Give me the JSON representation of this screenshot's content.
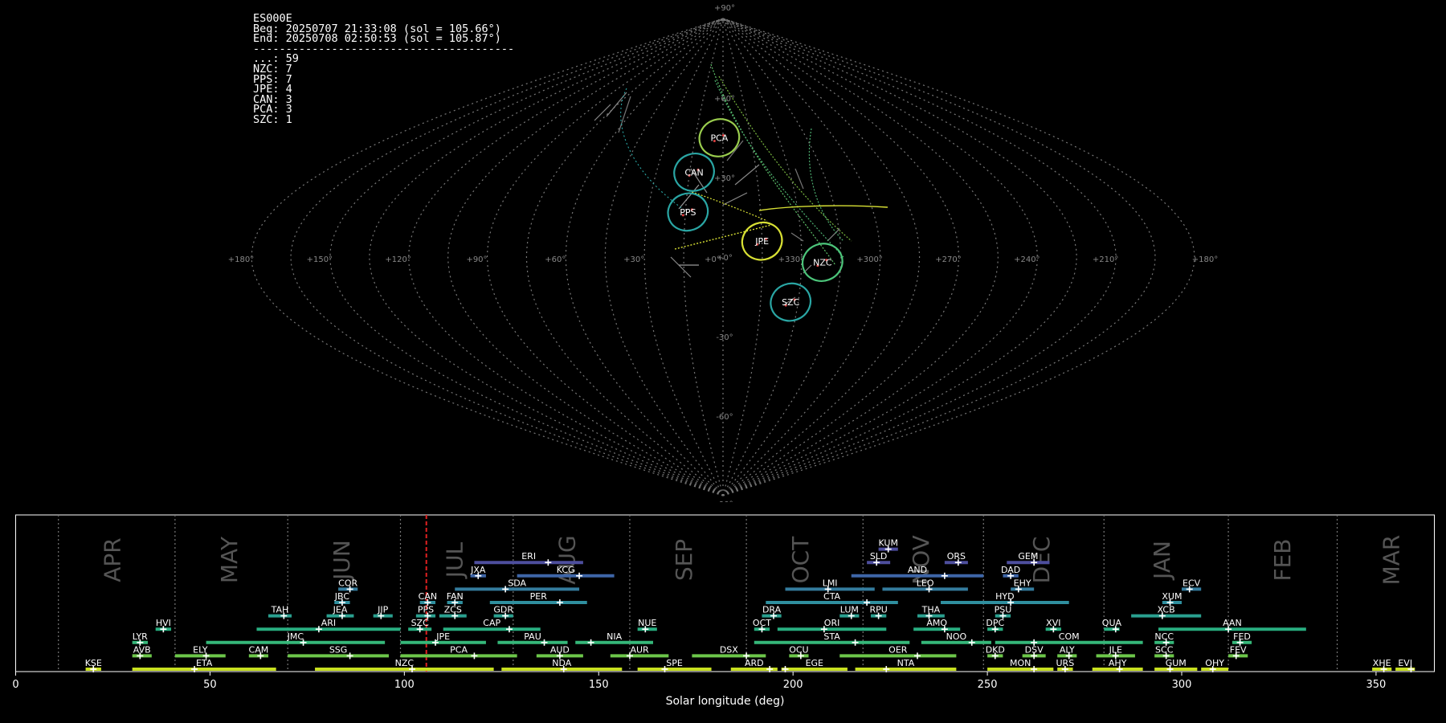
{
  "info": {
    "station": "ES000E",
    "beg": "Beg: 20250707 21:33:08 (sol = 105.66°)",
    "end": "End: 20250708 02:50:53 (sol = 105.87°)",
    "separator": "----------------------------------------",
    "counts": [
      {
        "label": "...",
        "count": 59
      },
      {
        "label": "NZC",
        "count": 7
      },
      {
        "label": "PPS",
        "count": 7
      },
      {
        "label": "JPE",
        "count": 4
      },
      {
        "label": "CAN",
        "count": 3
      },
      {
        "label": "PCA",
        "count": 3
      },
      {
        "label": "SZC",
        "count": 1
      }
    ]
  },
  "chart_data": [
    {
      "type": "scatter",
      "projection": "sinusoidal",
      "grid": true,
      "ra_ticks": [
        "+180°",
        "+150°",
        "+120°",
        "+90°",
        "+60°",
        "+30°",
        "+0°",
        "+330°",
        "+300°",
        "+270°",
        "+240°",
        "+210°",
        "+180°"
      ],
      "ra_tick_values": [
        180,
        150,
        120,
        90,
        60,
        30,
        0,
        330,
        300,
        270,
        240,
        210,
        180
      ],
      "dec_ticks": [
        "+90°",
        "+60°",
        "+30°",
        "+0°",
        "-30°",
        "-60°",
        "-90°"
      ],
      "dec_tick_values": [
        90,
        60,
        30,
        0,
        -30,
        -60,
        -90
      ],
      "radiants": [
        {
          "name": "PCA",
          "ra": 2,
          "dec": 45,
          "color": "#9acd4e"
        },
        {
          "name": "CAN",
          "ra": 13,
          "dec": 32,
          "color": "#2aa6a4"
        },
        {
          "name": "PPS",
          "ra": 14,
          "dec": 17,
          "color": "#2aa6a4"
        },
        {
          "name": "JPE",
          "ra": 345,
          "dec": 6,
          "color": "#d8e034"
        },
        {
          "name": "NZC",
          "ra": 322,
          "dec": -2,
          "color": "#4cc57a"
        },
        {
          "name": "SZC",
          "ra": 333,
          "dec": -17,
          "color": "#2aa6a4"
        }
      ]
    },
    {
      "type": "timeline",
      "xlabel": "Solar longitude (deg)",
      "xlim": [
        0,
        365
      ],
      "xticks": [
        0,
        50,
        100,
        150,
        200,
        250,
        300,
        350
      ],
      "current_sol": 105.66,
      "months": [
        {
          "name": "APR",
          "sol": 24
        },
        {
          "name": "MAY",
          "sol": 54
        },
        {
          "name": "JUN",
          "sol": 83
        },
        {
          "name": "JUL",
          "sol": 112
        },
        {
          "name": "AUG",
          "sol": 141
        },
        {
          "name": "SEP",
          "sol": 171
        },
        {
          "name": "OCT",
          "sol": 201
        },
        {
          "name": "NOV",
          "sol": 232
        },
        {
          "name": "DEC",
          "sol": 263
        },
        {
          "name": "JAN",
          "sol": 294
        },
        {
          "name": "FEB",
          "sol": 325
        },
        {
          "name": "MAR",
          "sol": 353
        }
      ],
      "month_bounds": [
        11,
        41,
        70,
        99,
        128,
        158,
        188,
        218,
        249,
        280,
        312,
        340
      ],
      "showers": [
        {
          "name": "KUM",
          "row": 10,
          "start": 222,
          "end": 227,
          "peak": 224.5,
          "color": "#4d4e9e"
        },
        {
          "name": "ERI",
          "row": 9,
          "start": 118,
          "end": 146,
          "peak": 137,
          "color": "#4d4e9e"
        },
        {
          "name": "SLD",
          "row": 9,
          "start": 219,
          "end": 225,
          "peak": 221.5,
          "color": "#4d4e9e"
        },
        {
          "name": "ORS",
          "row": 9,
          "start": 239,
          "end": 245,
          "peak": 242.5,
          "color": "#4d4e9e"
        },
        {
          "name": "GEM",
          "row": 9,
          "start": 255,
          "end": 266,
          "peak": 262,
          "color": "#4d4e9e"
        },
        {
          "name": "JXA",
          "row": 8,
          "start": 117,
          "end": 121,
          "peak": 119,
          "color": "#3e66a8"
        },
        {
          "name": "KCG",
          "row": 8,
          "start": 129,
          "end": 154,
          "peak": 145,
          "color": "#3e66a8"
        },
        {
          "name": "AND",
          "row": 8,
          "start": 215,
          "end": 249,
          "peak": 239,
          "color": "#3e66a8"
        },
        {
          "name": "DAD",
          "row": 8,
          "start": 254,
          "end": 258,
          "peak": 256,
          "color": "#3e66a8"
        },
        {
          "name": "COR",
          "row": 7,
          "start": 83,
          "end": 88,
          "peak": 86,
          "color": "#347c9e"
        },
        {
          "name": "SDA",
          "row": 7,
          "start": 113,
          "end": 145,
          "peak": 126,
          "color": "#347c9e"
        },
        {
          "name": "LMI",
          "row": 7,
          "start": 198,
          "end": 221,
          "peak": 209,
          "color": "#347c9e"
        },
        {
          "name": "LEO",
          "row": 7,
          "start": 223,
          "end": 245,
          "peak": 235,
          "color": "#347c9e"
        },
        {
          "name": "EHY",
          "row": 7,
          "start": 256,
          "end": 262,
          "peak": 258,
          "color": "#347c9e"
        },
        {
          "name": "ECV",
          "row": 7,
          "start": 300,
          "end": 305,
          "peak": 302,
          "color": "#347c9e"
        },
        {
          "name": "JBC",
          "row": 6,
          "start": 82,
          "end": 86,
          "peak": 84,
          "color": "#2f8f9f"
        },
        {
          "name": "CAN",
          "row": 6,
          "start": 104,
          "end": 108,
          "peak": 106,
          "color": "#2f8f9f"
        },
        {
          "name": "FAN",
          "row": 6,
          "start": 111,
          "end": 115,
          "peak": 113,
          "color": "#2f8f9f"
        },
        {
          "name": "PER",
          "row": 6,
          "start": 122,
          "end": 147,
          "peak": 140,
          "color": "#2f8f9f"
        },
        {
          "name": "CTA",
          "row": 6,
          "start": 193,
          "end": 227,
          "peak": 219,
          "color": "#2f8f9f"
        },
        {
          "name": "HYD",
          "row": 6,
          "start": 238,
          "end": 271,
          "peak": 256,
          "color": "#2f8f9f"
        },
        {
          "name": "XUM",
          "row": 6,
          "start": 295,
          "end": 300,
          "peak": 297,
          "color": "#2f8f9f"
        },
        {
          "name": "TAH",
          "row": 5,
          "start": 65,
          "end": 71,
          "peak": 69,
          "color": "#2aa08f"
        },
        {
          "name": "JEA",
          "row": 5,
          "start": 80,
          "end": 87,
          "peak": 84,
          "color": "#2aa08f"
        },
        {
          "name": "JIP",
          "row": 5,
          "start": 92,
          "end": 97,
          "peak": 94,
          "color": "#2aa08f"
        },
        {
          "name": "PPS",
          "row": 5,
          "start": 103,
          "end": 108,
          "peak": 106,
          "color": "#2aa08f"
        },
        {
          "name": "ZCS",
          "row": 5,
          "start": 109,
          "end": 116,
          "peak": 113,
          "color": "#2aa08f"
        },
        {
          "name": "GDR",
          "row": 5,
          "start": 123,
          "end": 128,
          "peak": 126,
          "color": "#2aa08f"
        },
        {
          "name": "DRA",
          "row": 5,
          "start": 192,
          "end": 197,
          "peak": 195,
          "color": "#2aa08f"
        },
        {
          "name": "LUM",
          "row": 5,
          "start": 212,
          "end": 217,
          "peak": 215,
          "color": "#2aa08f"
        },
        {
          "name": "RPU",
          "row": 5,
          "start": 220,
          "end": 224,
          "peak": 222,
          "color": "#2aa08f"
        },
        {
          "name": "THA",
          "row": 5,
          "start": 232,
          "end": 239,
          "peak": 235,
          "color": "#2aa08f"
        },
        {
          "name": "PSU",
          "row": 5,
          "start": 252,
          "end": 256,
          "peak": 254,
          "color": "#2aa08f"
        },
        {
          "name": "XCB",
          "row": 5,
          "start": 287,
          "end": 305,
          "peak": 295,
          "color": "#2aa08f"
        },
        {
          "name": "HVI",
          "row": 4,
          "start": 36,
          "end": 40,
          "peak": 38,
          "color": "#28ae80"
        },
        {
          "name": "ARI",
          "row": 4,
          "start": 62,
          "end": 99,
          "peak": 78,
          "color": "#28ae80"
        },
        {
          "name": "SZC",
          "row": 4,
          "start": 101,
          "end": 107,
          "peak": 104,
          "color": "#28ae80"
        },
        {
          "name": "CAP",
          "row": 4,
          "start": 110,
          "end": 135,
          "peak": 127,
          "color": "#28ae80"
        },
        {
          "name": "NUE",
          "row": 4,
          "start": 160,
          "end": 165,
          "peak": 162,
          "color": "#28ae80"
        },
        {
          "name": "OCT",
          "row": 4,
          "start": 190,
          "end": 194,
          "peak": 192,
          "color": "#28ae80"
        },
        {
          "name": "ORI",
          "row": 4,
          "start": 196,
          "end": 224,
          "peak": 208,
          "color": "#28ae80"
        },
        {
          "name": "AMO",
          "row": 4,
          "start": 231,
          "end": 243,
          "peak": 239,
          "color": "#28ae80"
        },
        {
          "name": "DPC",
          "row": 4,
          "start": 250,
          "end": 254,
          "peak": 252,
          "color": "#28ae80"
        },
        {
          "name": "XVI",
          "row": 4,
          "start": 265,
          "end": 269,
          "peak": 267,
          "color": "#28ae80"
        },
        {
          "name": "QUA",
          "row": 4,
          "start": 280,
          "end": 284,
          "peak": 283,
          "color": "#28ae80"
        },
        {
          "name": "AAN",
          "row": 4,
          "start": 294,
          "end": 332,
          "peak": 312,
          "color": "#28ae80"
        },
        {
          "name": "LYR",
          "row": 3,
          "start": 30,
          "end": 34,
          "peak": 32,
          "color": "#35b779"
        },
        {
          "name": "JMC",
          "row": 3,
          "start": 49,
          "end": 95,
          "peak": 74,
          "color": "#35b779"
        },
        {
          "name": "JPE",
          "row": 3,
          "start": 99,
          "end": 121,
          "peak": 108,
          "color": "#35b779"
        },
        {
          "name": "PAU",
          "row": 3,
          "start": 124,
          "end": 142,
          "peak": 136,
          "color": "#35b779"
        },
        {
          "name": "NIA",
          "row": 3,
          "start": 144,
          "end": 164,
          "peak": 148,
          "color": "#35b779"
        },
        {
          "name": "STA",
          "row": 3,
          "start": 190,
          "end": 230,
          "peak": 216,
          "color": "#35b779"
        },
        {
          "name": "NOO",
          "row": 3,
          "start": 233,
          "end": 251,
          "peak": 246,
          "color": "#35b779"
        },
        {
          "name": "COM",
          "row": 3,
          "start": 252,
          "end": 290,
          "peak": 262,
          "color": "#35b779"
        },
        {
          "name": "NCC",
          "row": 3,
          "start": 293,
          "end": 298,
          "peak": 296,
          "color": "#35b779"
        },
        {
          "name": "FED",
          "row": 3,
          "start": 313,
          "end": 318,
          "peak": 315,
          "color": "#35b779"
        },
        {
          "name": "AVB",
          "row": 2,
          "start": 30,
          "end": 35,
          "peak": 32,
          "color": "#6cc64a"
        },
        {
          "name": "ELY",
          "row": 2,
          "start": 41,
          "end": 54,
          "peak": 49,
          "color": "#6cc64a"
        },
        {
          "name": "CAM",
          "row": 2,
          "start": 60,
          "end": 65,
          "peak": 63,
          "color": "#6cc64a"
        },
        {
          "name": "SSG",
          "row": 2,
          "start": 70,
          "end": 96,
          "peak": 86,
          "color": "#6cc64a"
        },
        {
          "name": "PCA",
          "row": 2,
          "start": 99,
          "end": 129,
          "peak": 118,
          "color": "#6cc64a"
        },
        {
          "name": "AUD",
          "row": 2,
          "start": 134,
          "end": 146,
          "peak": 140,
          "color": "#6cc64a"
        },
        {
          "name": "AUR",
          "row": 2,
          "start": 153,
          "end": 168,
          "peak": 158,
          "color": "#6cc64a"
        },
        {
          "name": "DSX",
          "row": 2,
          "start": 174,
          "end": 193,
          "peak": 188,
          "color": "#6cc64a"
        },
        {
          "name": "OCU",
          "row": 2,
          "start": 199,
          "end": 204,
          "peak": 202,
          "color": "#6cc64a"
        },
        {
          "name": "OER",
          "row": 2,
          "start": 212,
          "end": 242,
          "peak": 232,
          "color": "#6cc64a"
        },
        {
          "name": "DKD",
          "row": 2,
          "start": 250,
          "end": 254,
          "peak": 252,
          "color": "#6cc64a"
        },
        {
          "name": "DSV",
          "row": 2,
          "start": 259,
          "end": 265,
          "peak": 262,
          "color": "#6cc64a"
        },
        {
          "name": "ALY",
          "row": 2,
          "start": 268,
          "end": 273,
          "peak": 271,
          "color": "#6cc64a"
        },
        {
          "name": "JLE",
          "row": 2,
          "start": 278,
          "end": 288,
          "peak": 283,
          "color": "#6cc64a"
        },
        {
          "name": "SCC",
          "row": 2,
          "start": 293,
          "end": 298,
          "peak": 296,
          "color": "#6cc64a"
        },
        {
          "name": "FEV",
          "row": 2,
          "start": 312,
          "end": 317,
          "peak": 314,
          "color": "#6cc64a"
        },
        {
          "name": "KSE",
          "row": 1,
          "start": 18,
          "end": 22,
          "peak": 20,
          "color": "#c8e020"
        },
        {
          "name": "ETA",
          "row": 1,
          "start": 30,
          "end": 67,
          "peak": 46,
          "color": "#c8e020"
        },
        {
          "name": "NZC",
          "row": 1,
          "start": 77,
          "end": 123,
          "peak": 102,
          "color": "#c8e020"
        },
        {
          "name": "NDA",
          "row": 1,
          "start": 125,
          "end": 156,
          "peak": 141,
          "color": "#c8e020"
        },
        {
          "name": "SPE",
          "row": 1,
          "start": 160,
          "end": 179,
          "peak": 167,
          "color": "#c8e020"
        },
        {
          "name": "ARD",
          "row": 1,
          "start": 184,
          "end": 196,
          "peak": 194,
          "color": "#c8e020"
        },
        {
          "name": "EGE",
          "row": 1,
          "start": 197,
          "end": 214,
          "peak": 198,
          "color": "#c8e020"
        },
        {
          "name": "NTA",
          "row": 1,
          "start": 216,
          "end": 242,
          "peak": 224,
          "color": "#c8e020"
        },
        {
          "name": "MON",
          "row": 1,
          "start": 250,
          "end": 267,
          "peak": 262,
          "color": "#c8e020"
        },
        {
          "name": "URS",
          "row": 1,
          "start": 268,
          "end": 272,
          "peak": 270,
          "color": "#c8e020"
        },
        {
          "name": "AHY",
          "row": 1,
          "start": 277,
          "end": 290,
          "peak": 284,
          "color": "#c8e020"
        },
        {
          "name": "GUM",
          "row": 1,
          "start": 293,
          "end": 304,
          "peak": 297,
          "color": "#c8e020"
        },
        {
          "name": "OHY",
          "row": 1,
          "start": 305,
          "end": 312,
          "peak": 308,
          "color": "#c8e020"
        },
        {
          "name": "XHE",
          "row": 1,
          "start": 349,
          "end": 354,
          "peak": 352,
          "color": "#c8e020"
        },
        {
          "name": "EVI",
          "row": 1,
          "start": 355,
          "end": 360,
          "peak": 359,
          "color": "#c8e020"
        }
      ]
    }
  ]
}
